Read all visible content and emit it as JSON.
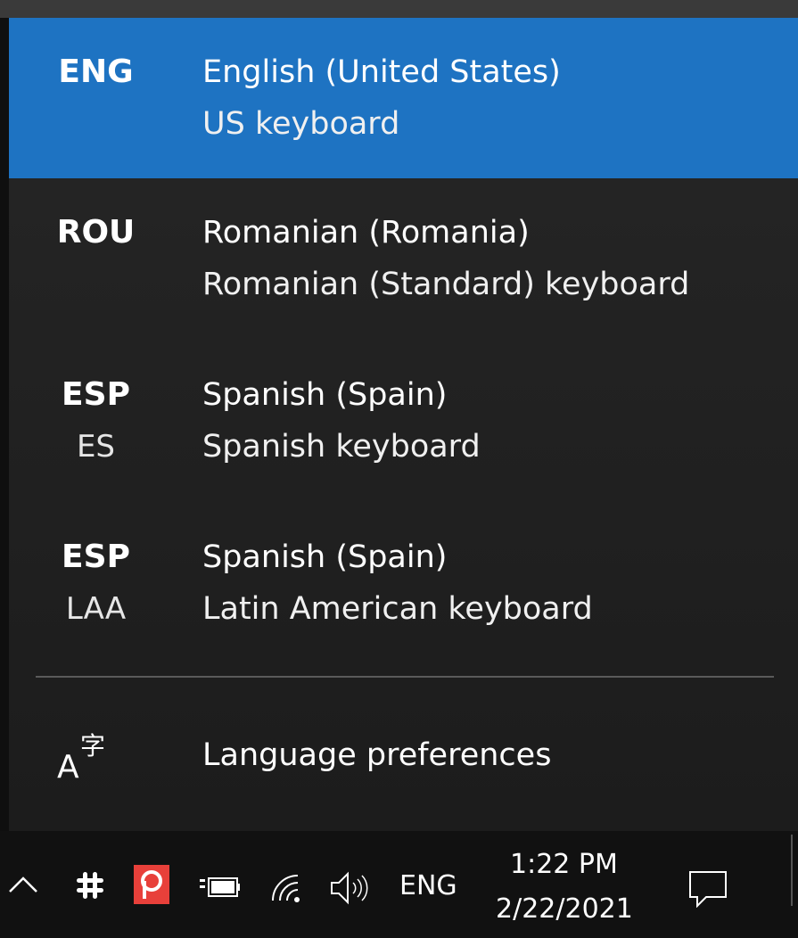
{
  "input_switcher": {
    "languages": [
      {
        "code": "ENG",
        "subcode": "",
        "name": "English (United States)",
        "keyboard": "US keyboard",
        "selected": true
      },
      {
        "code": "ROU",
        "subcode": "",
        "name": "Romanian (Romania)",
        "keyboard": "Romanian (Standard) keyboard",
        "selected": false
      },
      {
        "code": "ESP",
        "subcode": "ES",
        "name": "Spanish (Spain)",
        "keyboard": "Spanish keyboard",
        "selected": false
      },
      {
        "code": "ESP",
        "subcode": "LAA",
        "name": "Spanish (Spain)",
        "keyboard": "Latin American keyboard",
        "selected": false
      }
    ],
    "preferences": {
      "label": "Language preferences",
      "icon": "language-preferences-icon"
    }
  },
  "taskbar": {
    "language": "ENG",
    "time": "1:22 PM",
    "date": "2/22/2021",
    "tray_icons": [
      "chevron-up-icon",
      "slack-icon",
      "app-red-p-icon",
      "battery-charging-icon",
      "wifi-icon",
      "volume-icon",
      "notification-icon"
    ]
  },
  "colors": {
    "selected_bg": "#1e73c2",
    "flyout_bg": "#232323",
    "taskbar_bg": "#111111",
    "app_red": "#e8403a"
  }
}
